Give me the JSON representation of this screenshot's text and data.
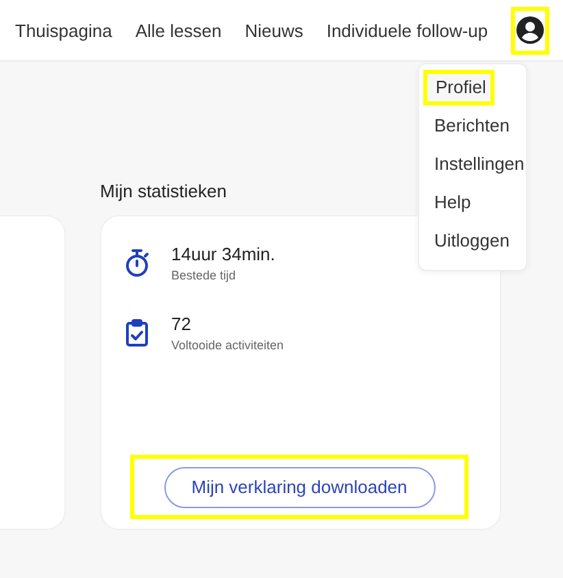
{
  "nav": {
    "items": [
      {
        "label": "Thuispagina"
      },
      {
        "label": "Alle lessen"
      },
      {
        "label": "Nieuws"
      },
      {
        "label": "Individuele follow-up"
      }
    ],
    "profile_button": {
      "highlighted": true
    }
  },
  "user_menu": {
    "items": [
      {
        "label": "Profiel",
        "highlighted": true
      },
      {
        "label": "Berichten",
        "highlighted": false
      },
      {
        "label": "Instellingen",
        "highlighted": false
      },
      {
        "label": "Help",
        "highlighted": false
      },
      {
        "label": "Uitloggen",
        "highlighted": false
      }
    ]
  },
  "stats": {
    "title": "Mijn statistieken",
    "items": [
      {
        "kind": "time",
        "value": "14uur 34min.",
        "label": "Bestede tijd"
      },
      {
        "kind": "activities",
        "value": "72",
        "label": "Voltooide activiteiten"
      }
    ],
    "download_button": {
      "label": "Mijn verklaring downloaden",
      "highlighted": true
    }
  }
}
